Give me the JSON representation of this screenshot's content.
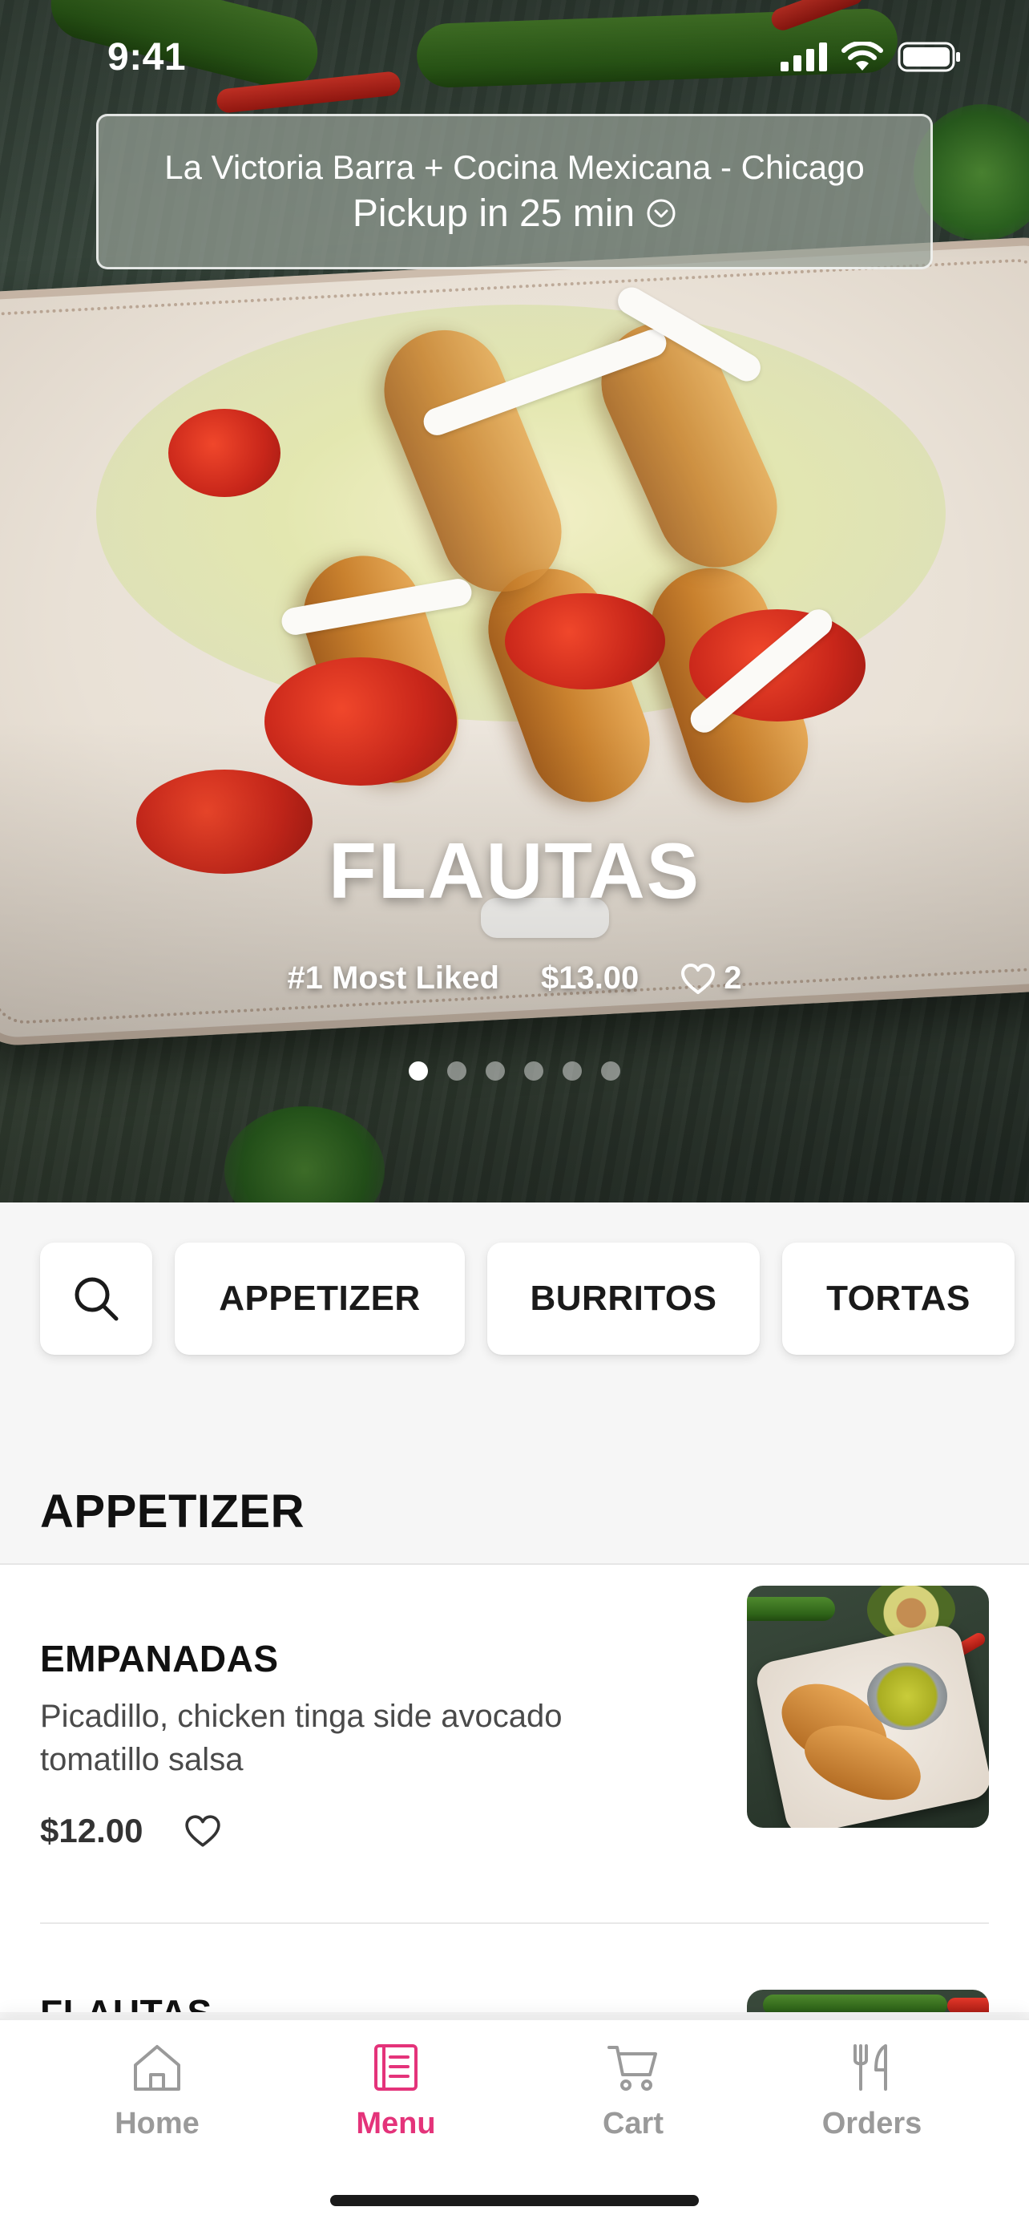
{
  "status_bar": {
    "time": "9:41"
  },
  "store": {
    "name": "La Victoria Barra + Cocina Mexicana - Chicago",
    "pickup": "Pickup in 25 min"
  },
  "featured": {
    "title": "FLAUTAS",
    "rank": "#1 Most Liked",
    "price": "$13.00",
    "likes": "2",
    "carousel": {
      "count": 6,
      "active_index": 0
    }
  },
  "categories": {
    "search_icon": "search-icon",
    "items": [
      "APPETIZER",
      "BURRITOS",
      "TORTAS"
    ]
  },
  "section": {
    "title": "APPETIZER"
  },
  "menu_items": [
    {
      "name": "EMPANADAS",
      "description": "Picadillo, chicken tinga side avocado tomatillo salsa",
      "price": "$12.00"
    },
    {
      "name": "FLAUTAS"
    }
  ],
  "tabbar": {
    "tabs": [
      {
        "label": "Home",
        "icon": "home-icon"
      },
      {
        "label": "Menu",
        "icon": "menu-icon"
      },
      {
        "label": "Cart",
        "icon": "cart-icon"
      },
      {
        "label": "Orders",
        "icon": "utensils-icon"
      }
    ],
    "active": "Menu"
  },
  "colors": {
    "accent": "#e4337a",
    "inactive_tab": "#9a9a9a",
    "background": "#f6f6f6"
  }
}
